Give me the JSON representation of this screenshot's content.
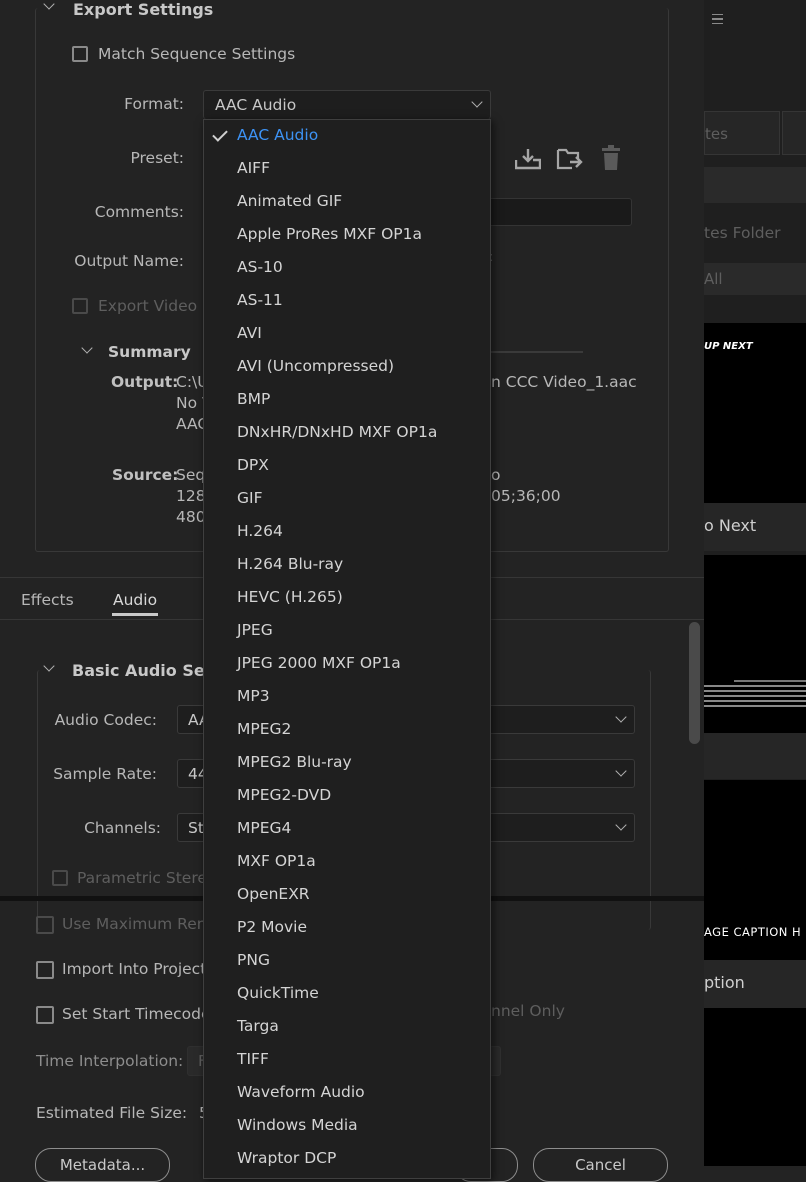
{
  "export_settings": {
    "section_title": "Export Settings",
    "match_sequence": "Match Sequence Settings",
    "format_label": "Format:",
    "format_value": "AAC Audio",
    "preset_label": "Preset:",
    "comments_label": "Comments:",
    "output_name_label": "Output Name:",
    "output_name_fragment": "c",
    "export_video": "Export Video",
    "summary_title": "Summary",
    "output_label": "Output:",
    "output_lines": [
      "C:\\U",
      "No V",
      "AAC"
    ],
    "output_tail": "n CCC Video_1.aac",
    "source_label": "Source:",
    "source_lines": [
      "Seq",
      "128",
      "480"
    ],
    "source_tail_1": "o",
    "source_tail_2": "05;36;00"
  },
  "tabs": [
    {
      "label": "Effects",
      "active": false
    },
    {
      "label": "Audio",
      "active": true
    }
  ],
  "audio": {
    "section_title": "Basic Audio Setti",
    "codec_label": "Audio Codec:",
    "codec_value": "AA",
    "sample_rate_label": "Sample Rate:",
    "sample_rate_value": "44",
    "channels_label": "Channels:",
    "channels_value": "St",
    "parametric_stereo": "Parametric Stere"
  },
  "bottom": {
    "max_render": "Use Maximum Ren",
    "import_project": "Import Into Project",
    "start_timecode": "Set Start Timecode",
    "channel_only": "nnel Only",
    "time_interp_label": "Time Interpolation:",
    "time_interp_value": "F",
    "est_size_label": "Estimated File Size:",
    "est_size_value": "5",
    "metadata_button": "Metadata...",
    "cancel_button": "Cancel"
  },
  "right_panel": {
    "tab_fragment": "tes",
    "folder_fragment": "tes Folder",
    "filter_fragment": "All",
    "thumb1_text": "UP NEXT",
    "thumb1_caption": "o Next",
    "thumb3_text": "AGE CAPTION H",
    "thumb3_caption": "ption"
  },
  "format_dropdown": {
    "selected": "AAC Audio",
    "items": [
      "AAC Audio",
      "AIFF",
      "Animated GIF",
      "Apple ProRes MXF OP1a",
      "AS-10",
      "AS-11",
      "AVI",
      "AVI (Uncompressed)",
      "BMP",
      "DNxHR/DNxHD MXF OP1a",
      "DPX",
      "GIF",
      "H.264",
      "H.264 Blu-ray",
      "HEVC (H.265)",
      "JPEG",
      "JPEG 2000 MXF OP1a",
      "MP3",
      "MPEG2",
      "MPEG2 Blu-ray",
      "MPEG2-DVD",
      "MPEG4",
      "MXF OP1a",
      "OpenEXR",
      "P2 Movie",
      "PNG",
      "QuickTime",
      "Targa",
      "TIFF",
      "Waveform Audio",
      "Windows Media",
      "Wraptor DCP"
    ]
  },
  "colors": {
    "accent": "#3d93f5",
    "background": "#232323",
    "dropdown_bg": "#1f1f1f"
  }
}
